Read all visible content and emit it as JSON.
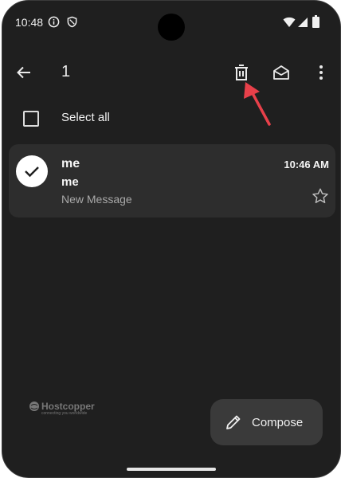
{
  "status_bar": {
    "time": "10:48"
  },
  "toolbar": {
    "selected_count": "1"
  },
  "list": {
    "select_all_label": "Select all",
    "items": [
      {
        "sender": "me",
        "time": "10:46 AM",
        "subject": "me",
        "preview": "New Message",
        "starred": false,
        "selected": true
      }
    ]
  },
  "watermark": {
    "text": "Hostcopper",
    "tagline": "connecting you worldwide"
  },
  "fab": {
    "label": "Compose"
  },
  "colors": {
    "background": "#1f1f1f",
    "card": "#2d2d2d",
    "fab": "#3a3a3a",
    "annotation_arrow": "#e8404a"
  }
}
